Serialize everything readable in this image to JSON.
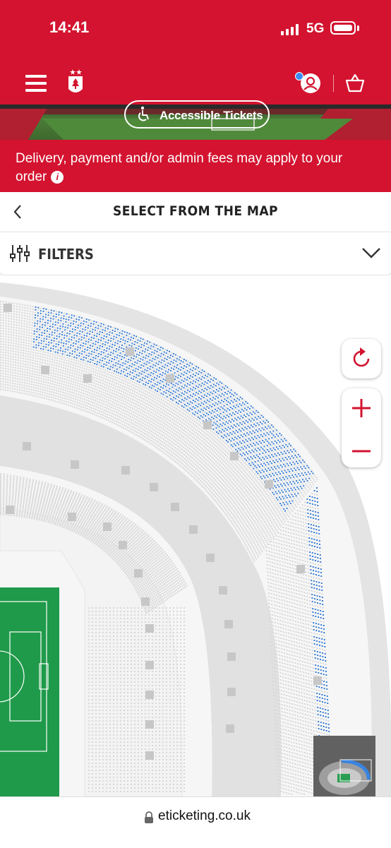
{
  "status": {
    "time": "14:41",
    "network": "5G"
  },
  "header": {
    "menu_icon": "hamburger-icon",
    "logo": "nottingham-forest-crest",
    "account_icon": "user-icon",
    "basket_icon": "basket-icon",
    "notification_color": "#3a8cf2"
  },
  "banner": {
    "accessible_label": "Accessible Tickets",
    "accessible_icon": "wheelchair-icon"
  },
  "notice": {
    "text": "Delivery, payment and/or admin fees may apply to your order",
    "icon": "info-icon"
  },
  "page": {
    "title": "SELECT FROM THE MAP",
    "back_icon": "chevron-left-icon"
  },
  "filters": {
    "label": "FILTERS",
    "icon": "sliders-icon",
    "chevron": "chevron-down-icon"
  },
  "map_controls": {
    "reset_icon": "reset-icon",
    "zoom_in_icon": "plus-icon",
    "zoom_out_icon": "minus-icon"
  },
  "colors": {
    "brand": "#d3132f",
    "available_seat": "#3a7fd6",
    "seat": "#d8d8d8",
    "pitch": "#1f9a4a"
  },
  "browser": {
    "url": "eticketing.co.uk"
  }
}
